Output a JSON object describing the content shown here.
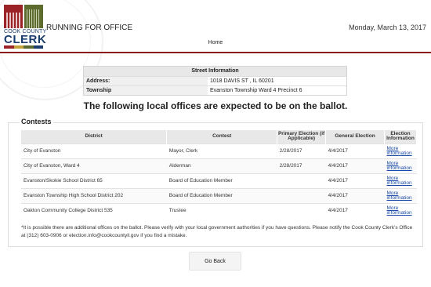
{
  "logo": {
    "county": "COOK COUNTY",
    "clerk": "CLERK",
    "bar_colors": [
      "#9b2226",
      "#c4a23a",
      "#5d6b2f",
      "#1a3d6d"
    ]
  },
  "header": {
    "title": "RUNNING FOR OFFICE",
    "date": "Monday, March 13, 2017",
    "home_link": "Home"
  },
  "street_info": {
    "heading": "Street Information",
    "rows": [
      {
        "label": "Address:",
        "value": "1018 DAVIS ST , IL 60201"
      },
      {
        "label": "Township",
        "value": "Evanston Township Ward 4 Precinct 6"
      }
    ]
  },
  "headline": "The following local offices are expected to be on the ballot.",
  "contests": {
    "legend": "Contests",
    "columns": [
      "District",
      "Contest",
      "Primary Election (if Applicable)",
      "General Election",
      "Election Information"
    ],
    "rows": [
      {
        "district": "City of Evanston",
        "contest": "Mayor, Clerk",
        "primary": "2/28/2017",
        "general": "4/4/2017",
        "info": "More information"
      },
      {
        "district": "City of Evanston, Ward 4",
        "contest": "Alderman",
        "primary": "2/28/2017",
        "general": "4/4/2017",
        "info": "More information"
      },
      {
        "district": "Evanston/Skokie School District 65",
        "contest": "Board of Education Member",
        "primary": "",
        "general": "4/4/2017",
        "info": "More information"
      },
      {
        "district": "Evanston Township High School District 202",
        "contest": "Board of Education Member",
        "primary": "",
        "general": "4/4/2017",
        "info": "More information"
      },
      {
        "district": "Oakton Community College District 535",
        "contest": "Trustee",
        "primary": "",
        "general": "4/4/2017",
        "info": "More information"
      }
    ],
    "footnote": "*It is possible there are additional offices on the ballot. Please verify with your local government authorities if you have questions. Please notify the Cook County Clerk's Office at (312) 603-0906 or election.info@cookcountyil.gov if you find a mistake."
  },
  "go_back_label": "Go Back"
}
